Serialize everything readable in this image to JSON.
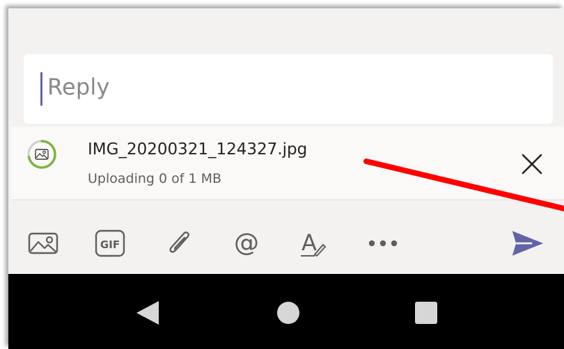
{
  "reply": {
    "placeholder": "Reply"
  },
  "attachment": {
    "file_name": "IMG_20200321_124327.jpg",
    "status": "Uploading 0 of 1 MB",
    "progress": 0.0,
    "icon": "image-file-icon"
  },
  "toolbar": {
    "items": [
      {
        "name": "image",
        "icon": "image-icon"
      },
      {
        "name": "gif",
        "icon": "gif-icon",
        "label": "GIF"
      },
      {
        "name": "attach",
        "icon": "paperclip-icon"
      },
      {
        "name": "mention",
        "icon": "at-sign-icon",
        "label": "@"
      },
      {
        "name": "format",
        "icon": "format-text-icon",
        "label": "A"
      },
      {
        "name": "more",
        "icon": "more-dots-icon",
        "label": "•••"
      },
      {
        "name": "send",
        "icon": "send-icon"
      }
    ]
  },
  "navbar": {
    "items": [
      "back-icon",
      "home-icon",
      "recents-icon"
    ]
  },
  "colors": {
    "accent": "#6264a7",
    "progress_ring": "#7cb342",
    "annotation_arrow": "#ff0000",
    "background": "#f3f2f1"
  }
}
